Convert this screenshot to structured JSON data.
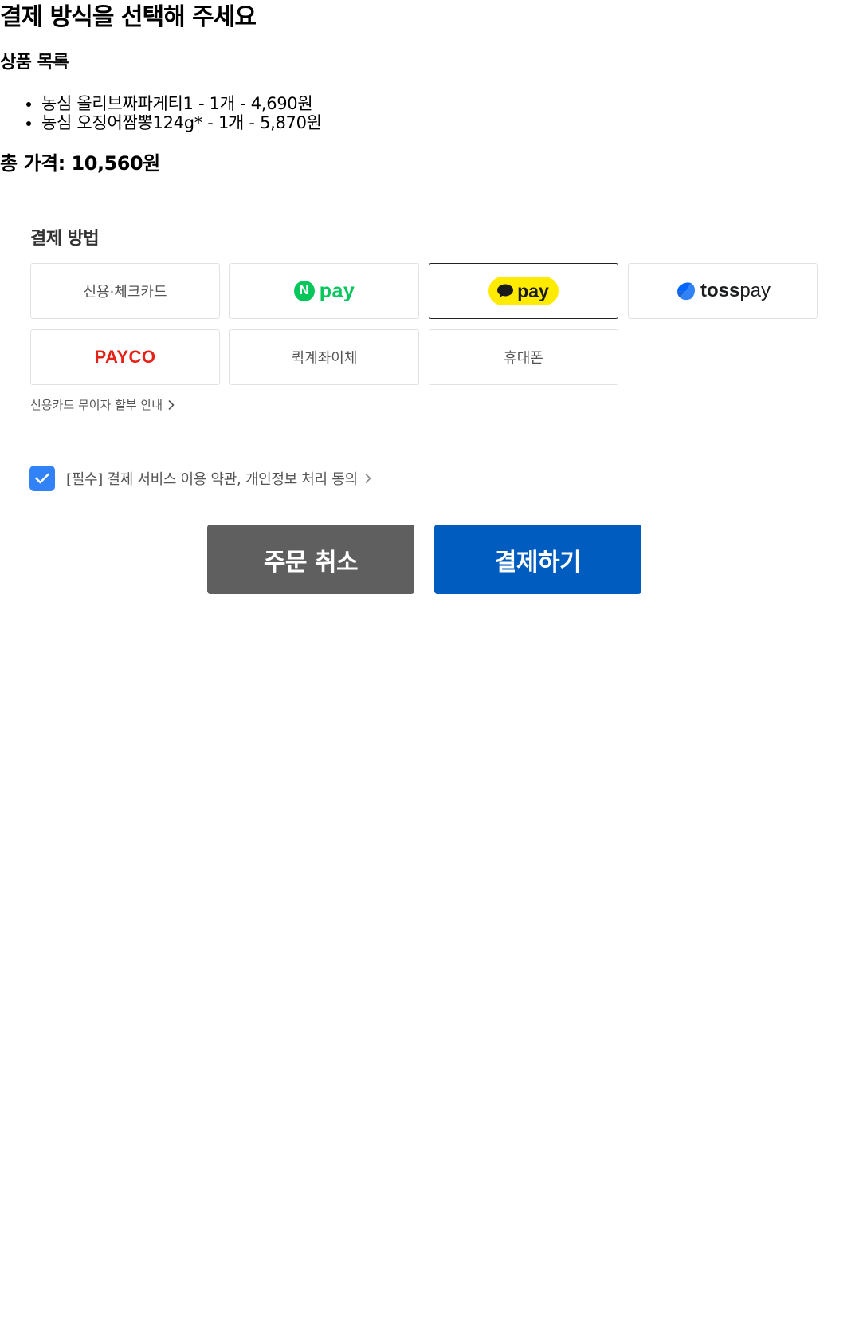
{
  "page": {
    "title": "결제 방식을 선택해 주세요"
  },
  "products": {
    "title": "상품 목록",
    "items": [
      "농심 올리브짜파게티1 - 1개 - 4,690원",
      "농심 오징어짬뽕124g* - 1개 - 5,870원"
    ]
  },
  "total": {
    "label": "총 가격: 10,560원"
  },
  "payment": {
    "heading": "결제 방법",
    "methods": {
      "card": "신용·체크카드",
      "npay_letter": "N",
      "npay": "pay",
      "kakaopay": "pay",
      "tosspay_bold": "toss",
      "tosspay": "pay",
      "payco": "PAYCO",
      "transfer": "퀵계좌이체",
      "phone": "휴대폰"
    },
    "selected": "kakaopay",
    "installment_link": "신용카드 무이자 할부 안내"
  },
  "agreement": {
    "checked": true,
    "text": "[필수] 결제 서비스 이용 약관, 개인정보 처리 동의"
  },
  "buttons": {
    "cancel": "주문 취소",
    "pay": "결제하기"
  },
  "colors": {
    "npay_green": "#03c75a",
    "kakao_yellow": "#ffeb00",
    "toss_blue": "#3182f6",
    "payco_red": "#e62117",
    "pay_button": "#005cbf",
    "cancel_button": "#5f5f5f"
  },
  "icons": {
    "checkbox": "check-icon",
    "link": "chevron-right-icon",
    "kakao": "speech-bubble-icon",
    "toss": "toss-logo-icon"
  }
}
